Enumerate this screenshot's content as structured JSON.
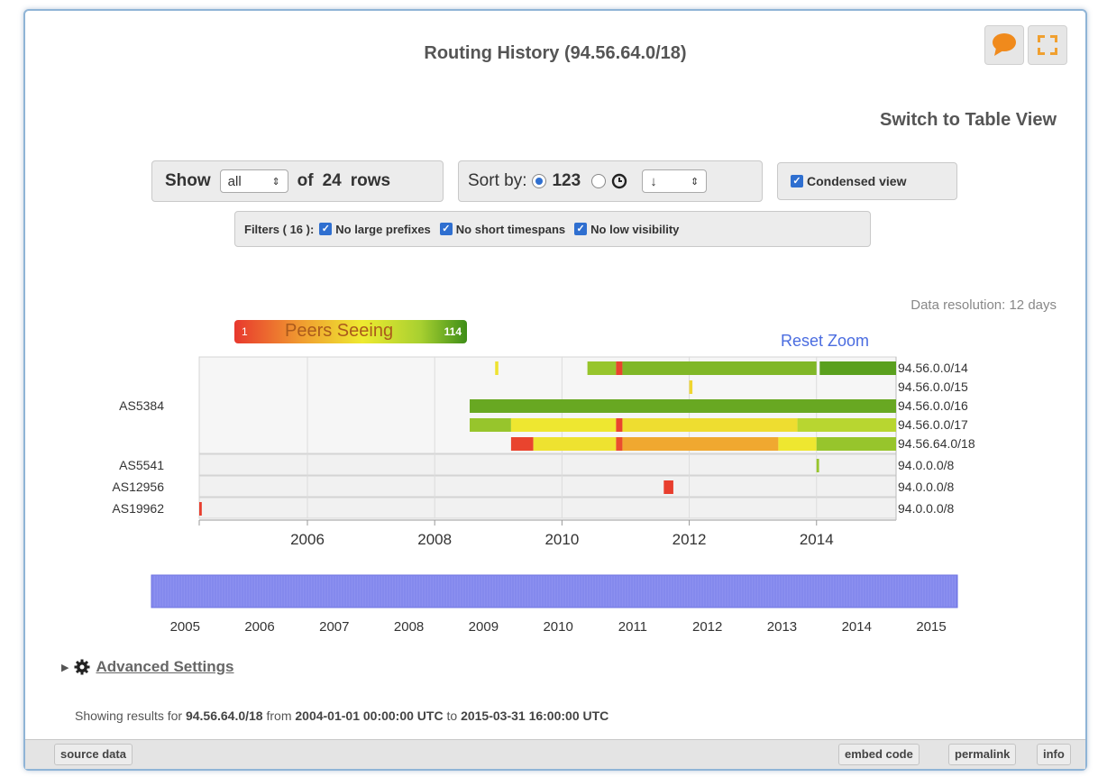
{
  "title": "Routing History (94.56.64.0/18)",
  "switch_view_label": "Switch to Table View",
  "show": {
    "label": "Show",
    "value": "all",
    "of": "of",
    "count": "24",
    "rows": "rows"
  },
  "sort": {
    "label": "Sort by:",
    "option_a": "123",
    "option_b_icon": "clock-icon",
    "direction": "↓"
  },
  "condensed_view_label": "Condensed view",
  "filters": {
    "label": "Filters ( 16 ):",
    "items": [
      "No large prefixes",
      "No short timespans",
      "No low visibility"
    ]
  },
  "data_resolution": "Data resolution: 12 days",
  "legend": {
    "min": "1",
    "label": "Peers Seeing",
    "max": "114",
    "color_low": "#e8382e",
    "color_mid": "#eeea30",
    "color_high": "#3e8e18"
  },
  "reset_zoom_label": "Reset Zoom",
  "chart_data": {
    "type": "heatmap",
    "value_meaning": "Peers Seeing",
    "x_range": [
      2004.3,
      2015.25
    ],
    "x_ticks": [
      "2006",
      "2008",
      "2010",
      "2012",
      "2014"
    ],
    "groups": [
      {
        "asn": "AS5384",
        "rows": [
          {
            "prefix": "94.56.0.0/14",
            "segments": [
              {
                "start": 2008.95,
                "end": 2009.0,
                "peers": 60
              },
              {
                "start": 2010.4,
                "end": 2010.85,
                "peers": 95
              },
              {
                "start": 2010.85,
                "end": 2010.95,
                "peers": 5
              },
              {
                "start": 2010.95,
                "end": 2014.0,
                "peers": 100
              },
              {
                "start": 2014.05,
                "end": 2015.25,
                "peers": 108
              }
            ]
          },
          {
            "prefix": "94.56.0.0/15",
            "segments": [
              {
                "start": 2012.0,
                "end": 2012.05,
                "peers": 55
              }
            ]
          },
          {
            "prefix": "94.56.0.0/16",
            "segments": [
              {
                "start": 2008.55,
                "end": 2015.25,
                "peers": 105
              }
            ]
          },
          {
            "prefix": "94.56.0.0/17",
            "segments": [
              {
                "start": 2008.55,
                "end": 2009.2,
                "peers": 95
              },
              {
                "start": 2009.2,
                "end": 2010.85,
                "peers": 62
              },
              {
                "start": 2010.85,
                "end": 2010.95,
                "peers": 5
              },
              {
                "start": 2010.95,
                "end": 2013.7,
                "peers": 58
              },
              {
                "start": 2013.7,
                "end": 2015.25,
                "peers": 85
              }
            ]
          },
          {
            "prefix": "94.56.64.0/18",
            "segments": [
              {
                "start": 2009.2,
                "end": 2009.55,
                "peers": 5
              },
              {
                "start": 2009.55,
                "end": 2010.85,
                "peers": 60
              },
              {
                "start": 2010.85,
                "end": 2010.95,
                "peers": 8
              },
              {
                "start": 2010.95,
                "end": 2013.4,
                "peers": 38
              },
              {
                "start": 2013.4,
                "end": 2014.0,
                "peers": 62
              },
              {
                "start": 2014.0,
                "end": 2015.25,
                "peers": 95
              }
            ]
          }
        ]
      },
      {
        "asn": "AS5541",
        "rows": [
          {
            "prefix": "94.0.0.0/8",
            "segments": [
              {
                "start": 2014.0,
                "end": 2014.04,
                "peers": 95
              }
            ]
          }
        ]
      },
      {
        "asn": "AS12956",
        "rows": [
          {
            "prefix": "94.0.0.0/8",
            "segments": [
              {
                "start": 2011.6,
                "end": 2011.75,
                "peers": 3
              }
            ]
          }
        ]
      },
      {
        "asn": "AS19962",
        "rows": [
          {
            "prefix": "94.0.0.0/8",
            "segments": [
              {
                "start": 2004.3,
                "end": 2004.34,
                "peers": 3
              }
            ]
          }
        ]
      }
    ],
    "navigator": {
      "x_range": [
        2004.55,
        2015.35
      ],
      "ticks": [
        "2005",
        "2006",
        "2007",
        "2008",
        "2009",
        "2010",
        "2011",
        "2012",
        "2013",
        "2014",
        "2015"
      ]
    }
  },
  "advanced_settings_label": "Advanced Settings",
  "status": {
    "prefix_text": "Showing results for",
    "resource": "94.56.64.0/18",
    "from_text": "from",
    "start": "2004-01-01 00:00:00 UTC",
    "to_text": "to",
    "end": "2015-03-31 16:00:00 UTC"
  },
  "footer": {
    "source_data": "source data",
    "embed_code": "embed code",
    "permalink": "permalink",
    "info": "info"
  }
}
